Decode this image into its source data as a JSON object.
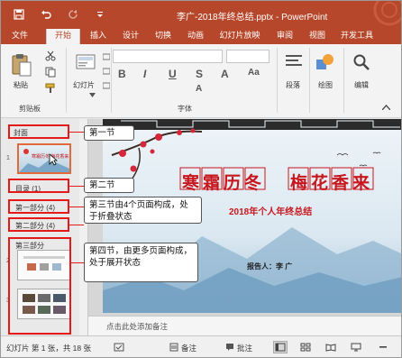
{
  "window": {
    "title": "李广-2018年终总结.pptx - PowerPoint"
  },
  "tabs": [
    "文件",
    "开始",
    "插入",
    "设计",
    "切换",
    "动画",
    "幻灯片放映",
    "审阅",
    "视图",
    "开发工具"
  ],
  "ribbon": {
    "paste_label": "粘贴",
    "new_slide_label": "幻灯片",
    "paragraph_label": "段落",
    "drawing_label": "绘图",
    "editing_label": "编辑",
    "clipboard_group": "剪贴板",
    "font_group": "字体",
    "bold": "B",
    "italic": "I",
    "underline": "U",
    "strike": "S",
    "font_a": "A",
    "font_aa": "Aa"
  },
  "sections": {
    "cover": "封面",
    "toc": "目录 (1)",
    "part1": "第一部分 (4)",
    "part2": "第二部分 (4)",
    "part3": "第三部分"
  },
  "slide_numbers": [
    "1",
    "2",
    "3"
  ],
  "thumbnail_text": {
    "slide1_title": "寒霜历冬 梅花香来"
  },
  "callouts": {
    "c1": "第一节",
    "c2": "第二节",
    "c3": "第三节由4个页面构成，处于折叠状态",
    "c4": "第四节，由更多页面构成，处于展开状态"
  },
  "slide": {
    "headline_left": "寒霜历冬",
    "headline_right": "梅花香来",
    "subtitle": "2018年个人年终总结",
    "reporter": "报告人：李 广"
  },
  "notes": {
    "placeholder": "点击此处添加备注"
  },
  "status": {
    "slide_info": "幻灯片 第 1 张，共 18 张",
    "notes_btn": "备注",
    "comments_btn": "批注"
  },
  "colors": {
    "accent": "#b7472a",
    "callout_border": "#e21a1a",
    "headline": "#c8161d"
  }
}
